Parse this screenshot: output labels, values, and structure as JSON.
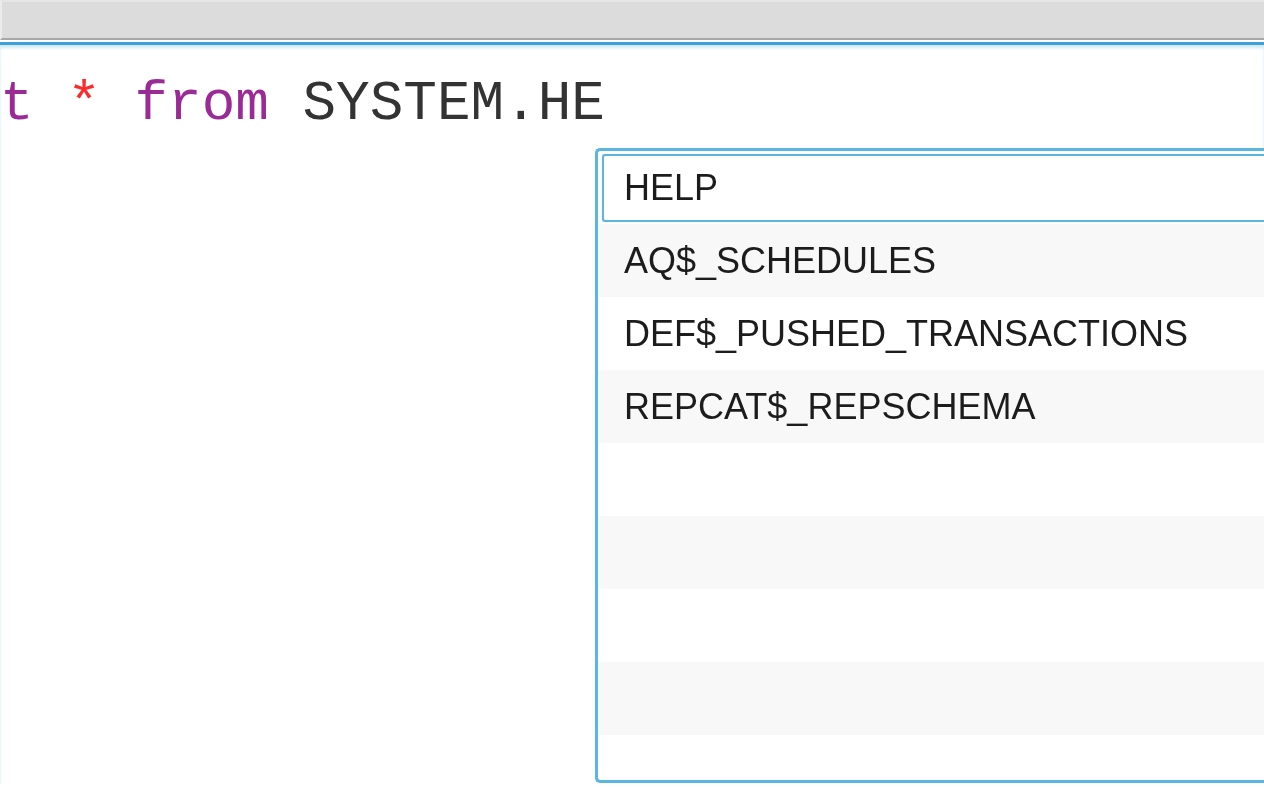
{
  "editor": {
    "tokens": [
      {
        "text": "t",
        "kind": "keyword"
      },
      {
        "text": "*",
        "kind": "operator"
      },
      {
        "text": "from",
        "kind": "keyword"
      },
      {
        "text": "SYSTEM.HE",
        "kind": "identifier"
      }
    ]
  },
  "autocomplete": {
    "items": [
      {
        "label": "HELP",
        "selected": true
      },
      {
        "label": "AQ$_SCHEDULES",
        "selected": false
      },
      {
        "label": "DEF$_PUSHED_TRANSACTIONS",
        "selected": false
      },
      {
        "label": "REPCAT$_REPSCHEMA",
        "selected": false
      }
    ]
  }
}
